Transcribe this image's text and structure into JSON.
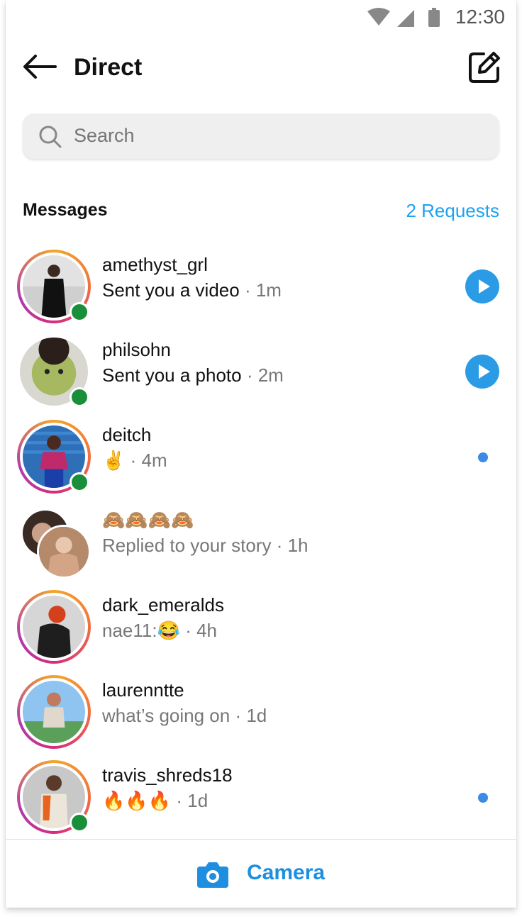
{
  "status": {
    "time": "12:30"
  },
  "header": {
    "title": "Direct"
  },
  "search": {
    "placeholder": "Search"
  },
  "section": {
    "label": "Messages",
    "requests": "2 Requests"
  },
  "threads": [
    {
      "name": "amethyst_grl",
      "preview": "Sent you a video",
      "time": "· 1m",
      "action": "play"
    },
    {
      "name": "philsohn",
      "preview": "Sent you a photo",
      "time": "· 2m",
      "action": "play"
    },
    {
      "name": "deitch",
      "preview": "✌️",
      "time": "· 4m",
      "action": "unread"
    },
    {
      "name": "🙈🙈🙈🙈",
      "preview": "Replied to your story",
      "time": "· 1h",
      "action": "none"
    },
    {
      "name": "dark_emeralds",
      "preview": "nae11:😂",
      "time": "· 4h",
      "action": "none"
    },
    {
      "name": "laurenntte",
      "preview": "what’s going on",
      "time": "· 1d",
      "action": "none"
    },
    {
      "name": "travis_shreds18",
      "preview": "🔥🔥🔥",
      "time": "· 1d",
      "action": "unread"
    }
  ],
  "bottom": {
    "label": "Camera"
  },
  "colors": {
    "accent": "#1da1f2",
    "online": "#1a8f3a",
    "unread": "#3b8be6"
  }
}
